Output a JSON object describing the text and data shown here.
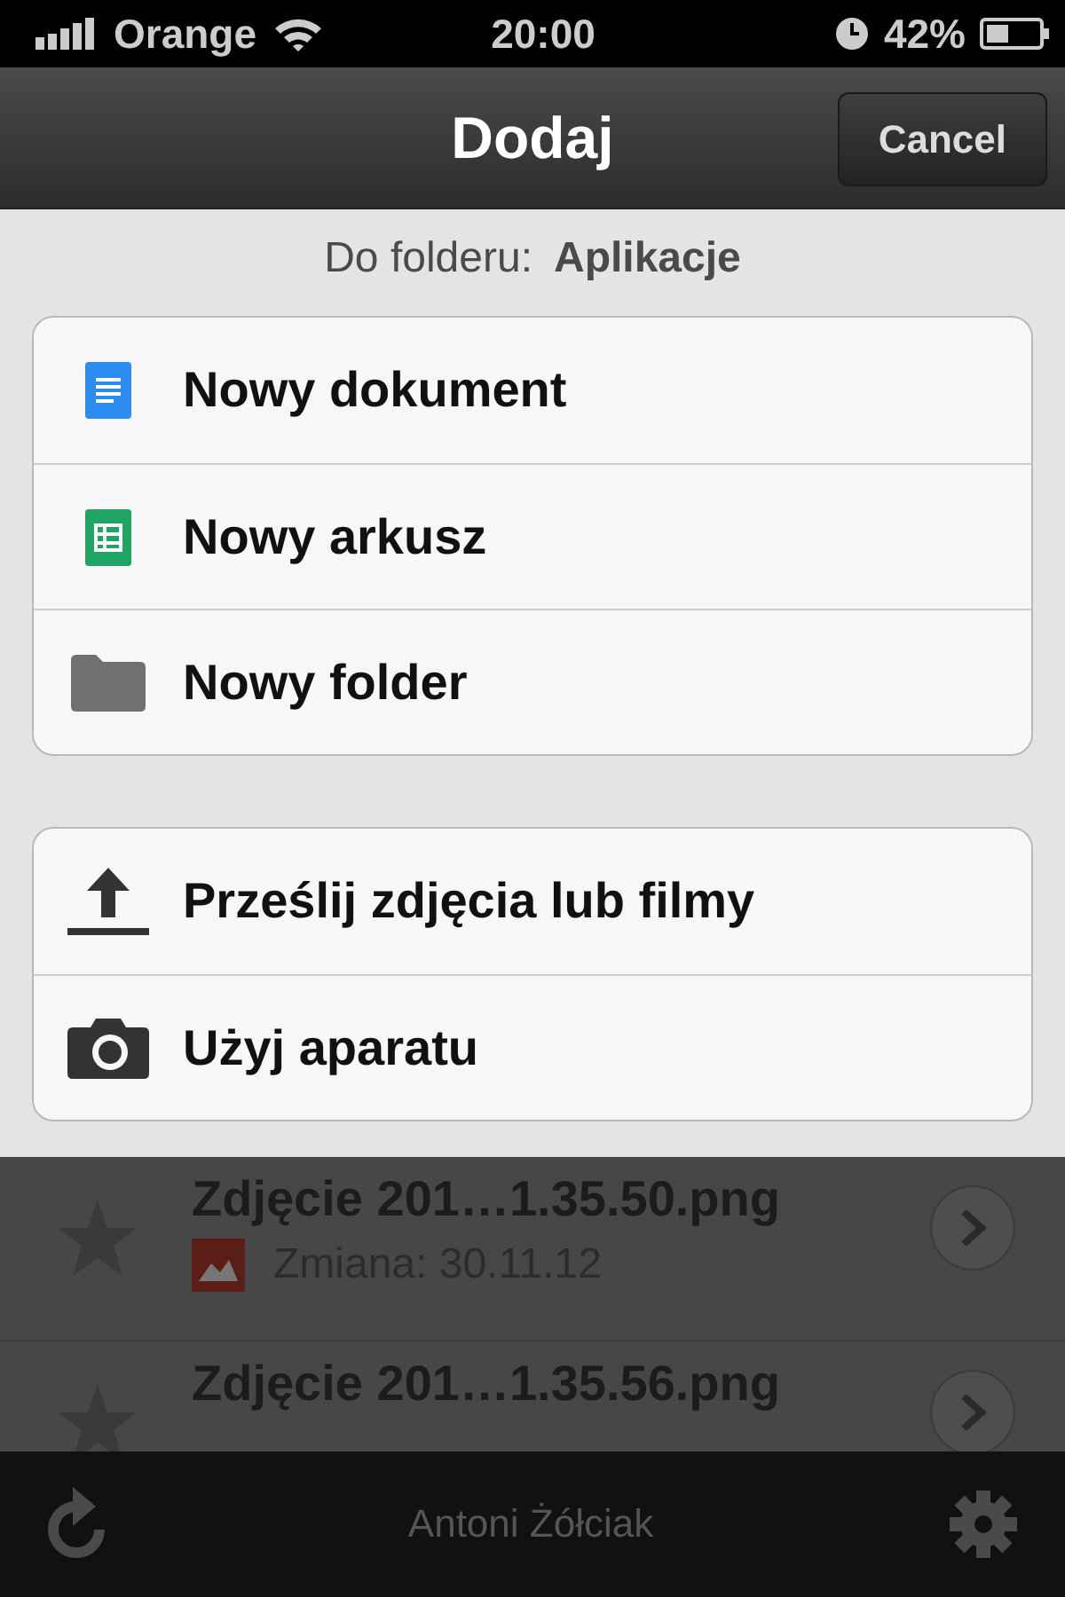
{
  "status_bar": {
    "carrier": "Orange",
    "time": "20:00",
    "battery": "42%"
  },
  "nav_bar": {
    "title": "Dodaj",
    "cancel": "Cancel"
  },
  "sheet": {
    "folder_label": "Do folderu:",
    "folder_name": "Aplikacje",
    "groups": [
      [
        {
          "kind": "document",
          "label": "Nowy dokument"
        },
        {
          "kind": "spreadsheet",
          "label": "Nowy arkusz"
        },
        {
          "kind": "folder",
          "label": "Nowy folder"
        }
      ],
      [
        {
          "kind": "upload",
          "label": "Prześlij zdjęcia lub filmy"
        },
        {
          "kind": "camera",
          "label": "Użyj aparatu"
        }
      ]
    ]
  },
  "files": [
    {
      "name": "Zdjęcie 201…1.35.50.png",
      "modified": "Zmiana: 30.11.12"
    },
    {
      "name": "Zdjęcie 201…1.35.56.png"
    }
  ],
  "toolbar": {
    "user": "Antoni Żółciak"
  }
}
